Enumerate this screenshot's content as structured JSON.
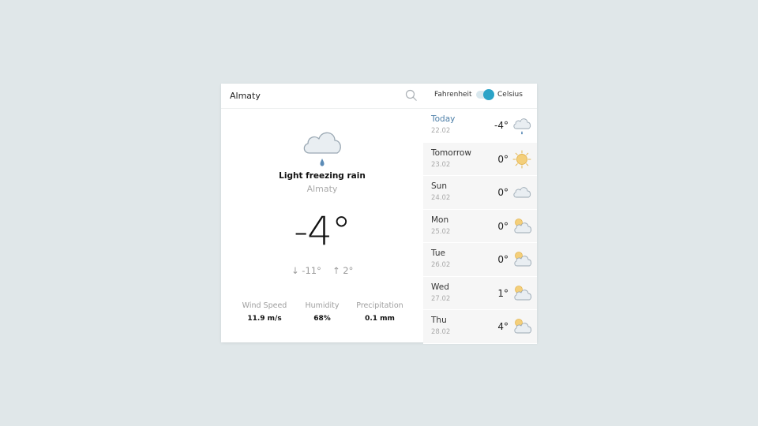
{
  "header": {
    "city_value": "Almaty",
    "unit_fahrenheit": "Fahrenheit",
    "unit_celsius": "Celsius",
    "celsius_selected": true
  },
  "current": {
    "icon": "cloud-freezing-rain-icon",
    "condition": "Light freezing rain",
    "city": "Almaty",
    "temperature": "-4°",
    "min": "-11°",
    "max": "2°",
    "stats": [
      {
        "label": "Wind Speed",
        "value": "11.9 m/s"
      },
      {
        "label": "Humidity",
        "value": "68%"
      },
      {
        "label": "Precipitation",
        "value": "0.1 mm"
      }
    ]
  },
  "forecast": [
    {
      "day": "Today",
      "date": "22.02",
      "temp": "-4°",
      "icon": "cloud-rain-icon"
    },
    {
      "day": "Tomorrow",
      "date": "23.02",
      "temp": "0°",
      "icon": "sun-icon"
    },
    {
      "day": "Sun",
      "date": "24.02",
      "temp": "0°",
      "icon": "cloud-icon"
    },
    {
      "day": "Mon",
      "date": "25.02",
      "temp": "0°",
      "icon": "partly-cloudy-icon"
    },
    {
      "day": "Tue",
      "date": "26.02",
      "temp": "0°",
      "icon": "partly-cloudy-icon"
    },
    {
      "day": "Wed",
      "date": "27.02",
      "temp": "1°",
      "icon": "partly-cloudy-icon"
    },
    {
      "day": "Thu",
      "date": "28.02",
      "temp": "4°",
      "icon": "partly-cloudy-icon"
    }
  ],
  "colors": {
    "background": "#e0e7e9",
    "accent": "#2ba3c7",
    "today_label": "#4d7fa8",
    "sun": "#f4cf7a",
    "cloud_fill": "#e9eef2",
    "cloud_stroke": "#9aa8b3",
    "raindrop": "#5b8bb6"
  }
}
